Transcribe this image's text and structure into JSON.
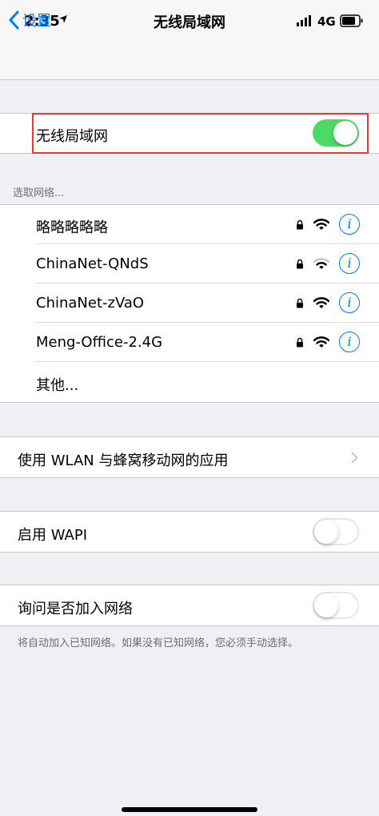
{
  "status_bar": {
    "time": "2:35",
    "network": "4G"
  },
  "nav": {
    "back_label": "设置",
    "title": "无线局域网"
  },
  "wifi_toggle": {
    "label": "无线局域网",
    "on": true
  },
  "networks_header": "选取网络...",
  "networks": [
    {
      "name": "略略略略略",
      "secured": true
    },
    {
      "name": "ChinaNet-QNdS",
      "secured": true
    },
    {
      "name": "ChinaNet-zVaO",
      "secured": true
    },
    {
      "name": "Meng-Office-2.4G",
      "secured": true
    }
  ],
  "other_label": "其他...",
  "wlan_apps_label": "使用 WLAN 与蜂窝移动网的应用",
  "wapi": {
    "label": "启用 WAPI",
    "on": false
  },
  "ask_join": {
    "label": "询问是否加入网络",
    "on": false
  },
  "footer_note": "将自动加入已知网络。如果没有已知网络，您必须手动选择。",
  "colors": {
    "accent": "#007aff",
    "toggle_on": "#4cd964",
    "highlight": "#e53935"
  }
}
